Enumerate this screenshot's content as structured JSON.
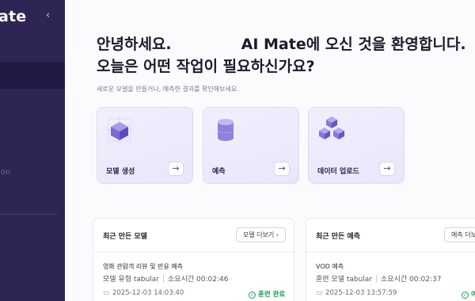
{
  "sidebar": {
    "brand": "ate",
    "collapse_icon": "‹",
    "items": [
      {
        "label": "ion"
      }
    ]
  },
  "main": {
    "greeting_part1": "안녕하세요.",
    "greeting_part2": "AI Mate에 오신 것을 환영합니다.",
    "greeting_line2": "오늘은 어떤 작업이 필요하신가요?",
    "subtitle": "새로운 모델을 만들거나, 예측한 결과를 확인해보세요.",
    "cards": [
      {
        "label": "모델 생성",
        "icon": "cube-icon"
      },
      {
        "label": "예측",
        "icon": "cylinder-icon"
      },
      {
        "label": "데이터 업로드",
        "icon": "cubes-icon"
      }
    ],
    "arrow": "→"
  },
  "panels": {
    "recent_models": {
      "title": "최근 만든 모델",
      "more_label": "모델 더보기 ›",
      "item": {
        "title": "영화 관람객 리뷰 및 반응 예측",
        "type_label": "모델 유형 tabular",
        "duration_label": "소요시간 00:02:46",
        "date": "2025-12-03 14:03:40",
        "status": "훈련 완료"
      }
    },
    "recent_predictions": {
      "title": "최근 만든 예측",
      "more_label": "예측 더보기",
      "item": {
        "title": "VOD 예측",
        "type_label": "훈련 모델 tabular",
        "duration_label": "소요시간 00:02:37",
        "date": "2025-12-03 13:57:59",
        "status": "예"
      }
    }
  },
  "colors": {
    "sidebar_bg": "#2e2554",
    "accent": "#6b5fc7",
    "success": "#1f9d55"
  }
}
